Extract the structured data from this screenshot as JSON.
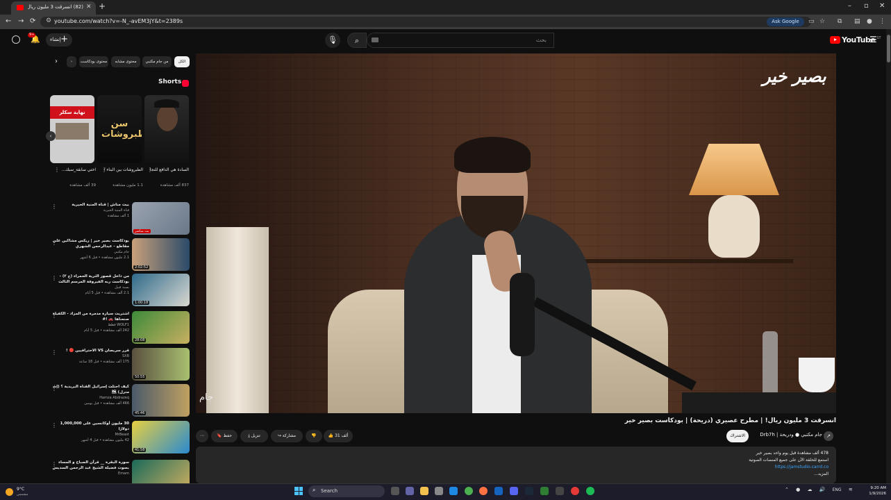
{
  "browser": {
    "tab_title": "(82) انسرقت 3 مليون ريال| مطرح",
    "url": "youtube.com/watch?v=-N_-avEM3jY&t=2389s",
    "ask_google": "Ask Google"
  },
  "header": {
    "logo": "YouTube",
    "logo_sup": "ST",
    "search_placeholder": "بحث",
    "create_label": "إنشاء",
    "notif_count": "9+"
  },
  "chips": [
    "الكل",
    "من جام مكتبي",
    "محتوى مشابه",
    "محتوى بودكاست"
  ],
  "shorts": {
    "heading": "Shorts",
    "items": [
      {
        "title": "السادة هي الدافع للنجاح 🏆 |...",
        "views": "837 ألف مشاهدة",
        "overlay": ""
      },
      {
        "title": "الطبروشات بين البناء // نقسم ...",
        "views": "1.1 مليون مشاهدة",
        "overlay": "سن الطبروشات"
      },
      {
        "title": "اختي سابقة_سبك...",
        "views": "39 ألف مشاهدة",
        "overlay": "نهاية سكلر"
      }
    ]
  },
  "recommendations": [
    {
      "title1": "بيت مناش | قناة المنبة الحيرية",
      "title2": "",
      "channel": "قناة المنبة الحيرية",
      "meta": "1 ألف مشاهدة",
      "duration": "بث مباشر"
    },
    {
      "title1": "بودكاست بصير خير | ريكس مشاكين على",
      "title2": "مقاطع - عبدالرحمن الشهري",
      "channel": "جام مكتبي",
      "meta": "2.1 مليون مشاهدة • قبل 6 أشهر",
      "duration": "2:02:52"
    },
    {
      "title1": "من داخل قصور الثرية الحمراء (ج ٢) -",
      "title2": "بودكاست ربه الفيروقة المرسم الثالث",
      "channel": "بسبة قبيل",
      "meta": "2.1 ألف مشاهدة • قبل 5 أيام",
      "duration": "1:00:18"
    },
    {
      "title1": "اشتريت سيارة مدمرة من المزاد - الكفيلة",
      "title2": "صنعناها 🚗 !#",
      "channel": "WOLF1 قطط",
      "meta": "242 ألف مشاهدة • قبل 5 أيام",
      "duration": "28:08"
    },
    {
      "title1": "قرر سريصان VS الاحترافيين 🔴 !",
      "title2": "",
      "channel": "SXB",
      "meta": "175 ألف مشاهدة • قبل 18 ساعة",
      "duration": "50:55"
    },
    {
      "title1": "كيف احتلت إسرائيل القناة البريدية ؟ (إشكال",
      "title2": "مترل) 🗺",
      "channel": "Hamza Abdrazeq",
      "meta": "466 ألف مشاهدة • قبل يومين",
      "duration": "45:46"
    },
    {
      "title1": "30 مليون أوكانسين على 1,000,000",
      "title2": "دولارًا",
      "channel": "MrBeast",
      "meta": "42 مليون مشاهدة • قبل 4 أشهر",
      "duration": "41:58"
    },
    {
      "title1": "سورة البقرة __ قرآن الصباح و المساء",
      "title2": "بصوت فضيلة الشيخ عبد الرحمن السديس | ...",
      "channel": "Emam",
      "meta": "",
      "duration": ""
    }
  ],
  "video": {
    "watermark": "بصير خير",
    "bottom_logo": "جام",
    "title": "انسرقت 3 مليون ريال! | مطرح عصيري (دريحة) | بودكاست بصير خير",
    "channel_name": "جام مكتبي ● ودريحة | Drb7h",
    "join": "الاشتراك",
    "likes": "31 ألف",
    "share": "مشاركة",
    "download": "تنزيل",
    "save": "حفظ",
    "views_date": "478 ألف مشاهدة  قبل يوم واحد  بصير خير",
    "desc_line": "استمع للحلقة الآن على جميع المنصات الصوتية",
    "desc_link": "https://jamstudio.carrd.co",
    "more": "...المزيد"
  },
  "taskbar": {
    "temp": "9°C",
    "weather_desc": "مشمس",
    "search": "Search",
    "lang": "ENG",
    "time": "9:20 AM",
    "date": "1/9/2026"
  },
  "colors": {
    "yt_red": "#ff0000",
    "bg": "#0f0f0f",
    "chip_bg": "#272727",
    "link": "#3ea6ff"
  }
}
